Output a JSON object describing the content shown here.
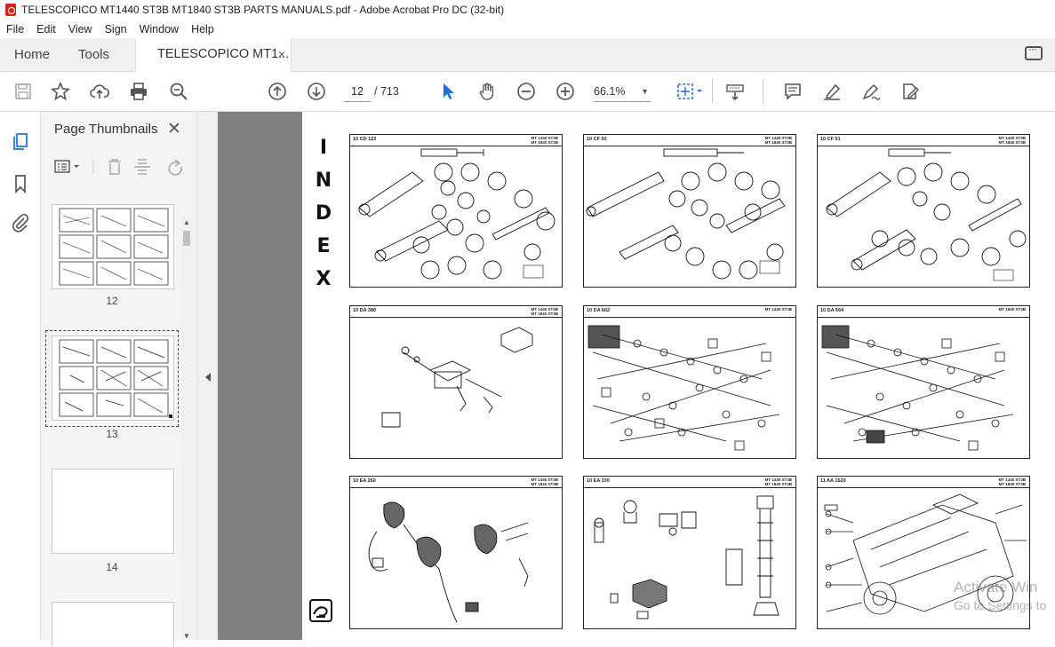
{
  "window": {
    "title": "TELESCOPICO MT1440 ST3B  MT1840 ST3B PARTS MANUALS.pdf - Adobe Acrobat Pro DC (32-bit)"
  },
  "menu": [
    "File",
    "Edit",
    "View",
    "Sign",
    "Window",
    "Help"
  ],
  "tabs": {
    "home": "Home",
    "tools": "Tools",
    "document": "TELESCOPICO MT1...",
    "close": "×"
  },
  "toolbar": {
    "current_page": "12",
    "total_pages": "/ 713",
    "zoom": "66.1%"
  },
  "panel": {
    "title": "Page Thumbnails",
    "close": "✕",
    "thumbnails": [
      {
        "label": "12",
        "selected": false
      },
      {
        "label": "13",
        "selected": true
      },
      {
        "label": "14",
        "selected": false
      }
    ]
  },
  "document_page": {
    "index_letters": [
      "I",
      "N",
      "D",
      "E",
      "X"
    ],
    "cells": [
      {
        "code": "10 CD 122",
        "model": [
          "MT 1440 ST3B",
          "MT 1840 ST3B"
        ]
      },
      {
        "code": "10 CF 50",
        "model": [
          "MT 1440 ST3B",
          "MT 1840 ST3B"
        ]
      },
      {
        "code": "10 CF 51",
        "model": [
          "MT 1440 ST3B",
          "MT 1840 ST3B"
        ]
      },
      {
        "code": "10 DA 380",
        "model": [
          "MT 1440 ST3B",
          "MT 1840 ST3B"
        ]
      },
      {
        "code": "10 DA 662",
        "model": [
          "MT 1440 ST3B",
          ""
        ]
      },
      {
        "code": "10 DA 664",
        "model": [
          "MT 1840 ST3B",
          ""
        ]
      },
      {
        "code": "10 EA 260",
        "model": [
          "MT 1440 ST3B",
          "MT 1840 ST3B"
        ]
      },
      {
        "code": "10 EA 330",
        "model": [
          "MT 1440 ST3B",
          "MT 1840 ST3B"
        ]
      },
      {
        "code": "11 AA 1620",
        "model": [
          "MT 1440 ST3B",
          "MT 1840 ST3B"
        ]
      }
    ]
  },
  "watermark": {
    "line1": "Activate Win",
    "line2": "Go to Settings to"
  },
  "colors": {
    "accent_blue": "#1f6fd6",
    "viewer_gray": "#7f7f7f",
    "pdf_red": "#d1241b"
  }
}
